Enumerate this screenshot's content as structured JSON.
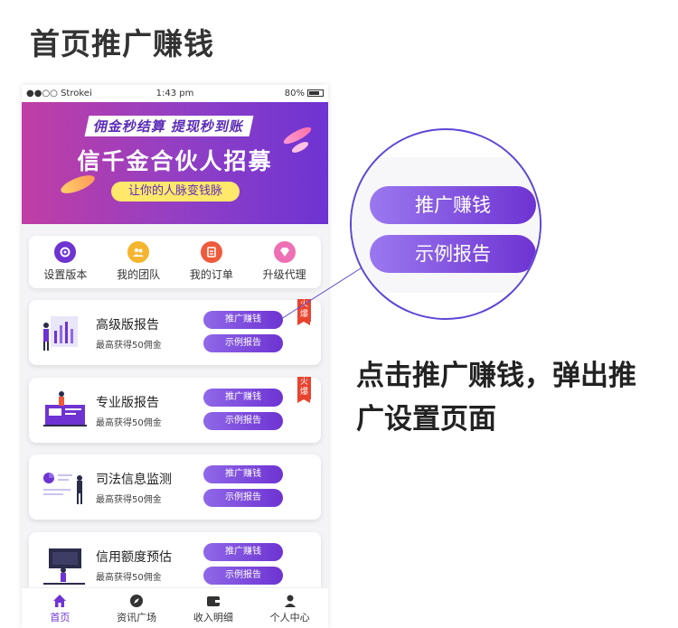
{
  "page_title": "首页推广赚钱",
  "status_bar": {
    "carrier": "●●○○ Strokei",
    "time": "1:43 pm",
    "battery": "80%"
  },
  "banner": {
    "top_line": "佣金秒结算 提现秒到账",
    "main_line": "信千金合伙人招募",
    "sub_line": "让你的人脉变钱脉"
  },
  "menu": [
    {
      "label": "设置版本",
      "icon": "settings-icon",
      "color": "#6e33d2"
    },
    {
      "label": "我的团队",
      "icon": "team-icon",
      "color": "#f5b52e"
    },
    {
      "label": "我的订单",
      "icon": "order-icon",
      "color": "#ef5a3c"
    },
    {
      "label": "升级代理",
      "icon": "diamond-icon",
      "color": "#ee6fb3"
    }
  ],
  "cards": [
    {
      "title": "高级版报告",
      "desc": "最高获得50佣金",
      "promo_btn": "推广赚钱",
      "example_btn": "示例报告",
      "hot": "火爆"
    },
    {
      "title": "专业版报告",
      "desc": "最高获得50佣金",
      "promo_btn": "推广赚钱",
      "example_btn": "示例报告",
      "hot": "火爆"
    },
    {
      "title": "司法信息监测",
      "desc": "最高获得50佣金",
      "promo_btn": "推广赚钱",
      "example_btn": "示例报告",
      "hot": ""
    },
    {
      "title": "信用额度预估",
      "desc": "最高获得50佣金",
      "promo_btn": "推广赚钱",
      "example_btn": "示例报告",
      "hot": ""
    }
  ],
  "tabbar": [
    {
      "label": "首页",
      "icon": "home-icon",
      "active": true
    },
    {
      "label": "资讯广场",
      "icon": "compass-icon",
      "active": false
    },
    {
      "label": "收入明细",
      "icon": "wallet-icon",
      "active": false
    },
    {
      "label": "个人中心",
      "icon": "user-icon",
      "active": false
    }
  ],
  "zoom": {
    "promo_btn": "推广赚钱",
    "example_btn": "示例报告"
  },
  "annotation": "点击推广赚钱，弹出推广设置页面",
  "colors": {
    "accent": "#6e33d2",
    "hot": "#e8432e",
    "banner_start": "#c03ea5"
  }
}
